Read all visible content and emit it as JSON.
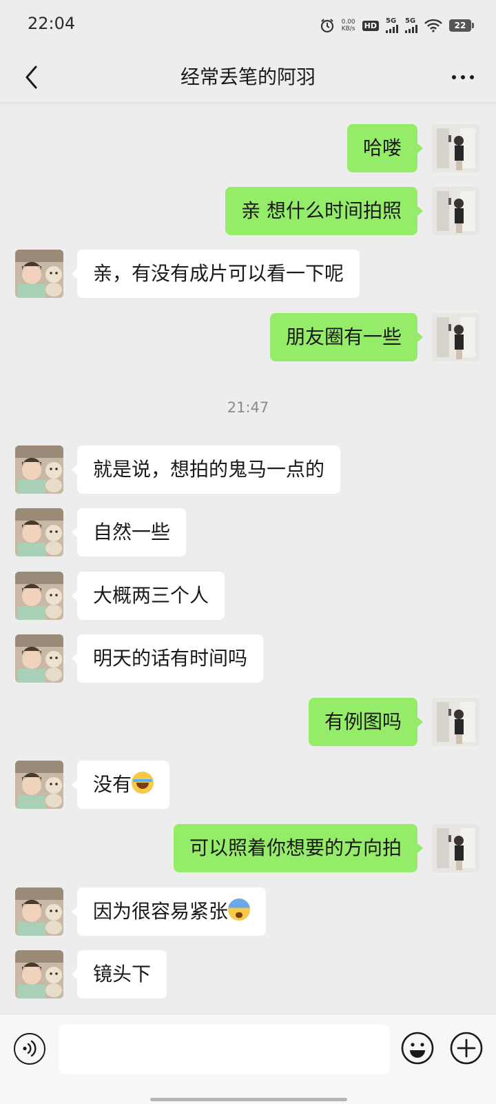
{
  "status_bar": {
    "time": "22:04",
    "net_speed_value": "0.00",
    "net_speed_unit": "KB/s",
    "hd_label": "HD",
    "sim1_label": "5G",
    "sim2_label": "5G",
    "battery": "22",
    "icons": [
      "alarm-icon",
      "hd-icon",
      "signal-icon",
      "wifi-icon",
      "battery-icon"
    ]
  },
  "header": {
    "title": "经常丢笔的阿羽",
    "icons": [
      "back-icon",
      "more-icon"
    ]
  },
  "messages": [
    {
      "side": "out",
      "text": "哈喽"
    },
    {
      "side": "out",
      "text": "亲 想什么时间拍照"
    },
    {
      "side": "in",
      "text": "亲，有没有成片可以看一下呢"
    },
    {
      "side": "out",
      "text": "朋友圈有一些"
    },
    {
      "type": "time",
      "text": "21:47"
    },
    {
      "side": "in",
      "text": "就是说，想拍的鬼马一点的"
    },
    {
      "side": "in",
      "text": "自然一些"
    },
    {
      "side": "in",
      "text": "大概两三个人"
    },
    {
      "side": "in",
      "text": "明天的话有时间吗"
    },
    {
      "side": "out",
      "text": "有例图吗"
    },
    {
      "side": "in",
      "text": "没有",
      "emoji": "face-with-tears-of-joy-emoji"
    },
    {
      "side": "out",
      "text": "可以照着你想要的方向拍"
    },
    {
      "side": "in",
      "text": "因为很容易紧张",
      "emoji": "fearful-face-emoji"
    },
    {
      "side": "in",
      "text": "镜头下"
    }
  ],
  "input_bar": {
    "placeholder": "",
    "icons": [
      "voice-icon",
      "emoji-icon",
      "plus-icon"
    ]
  },
  "colors": {
    "background": "#ededed",
    "outgoing_bubble": "#95ec69",
    "incoming_bubble": "#ffffff",
    "timestamp_text": "#8a8a8a"
  }
}
